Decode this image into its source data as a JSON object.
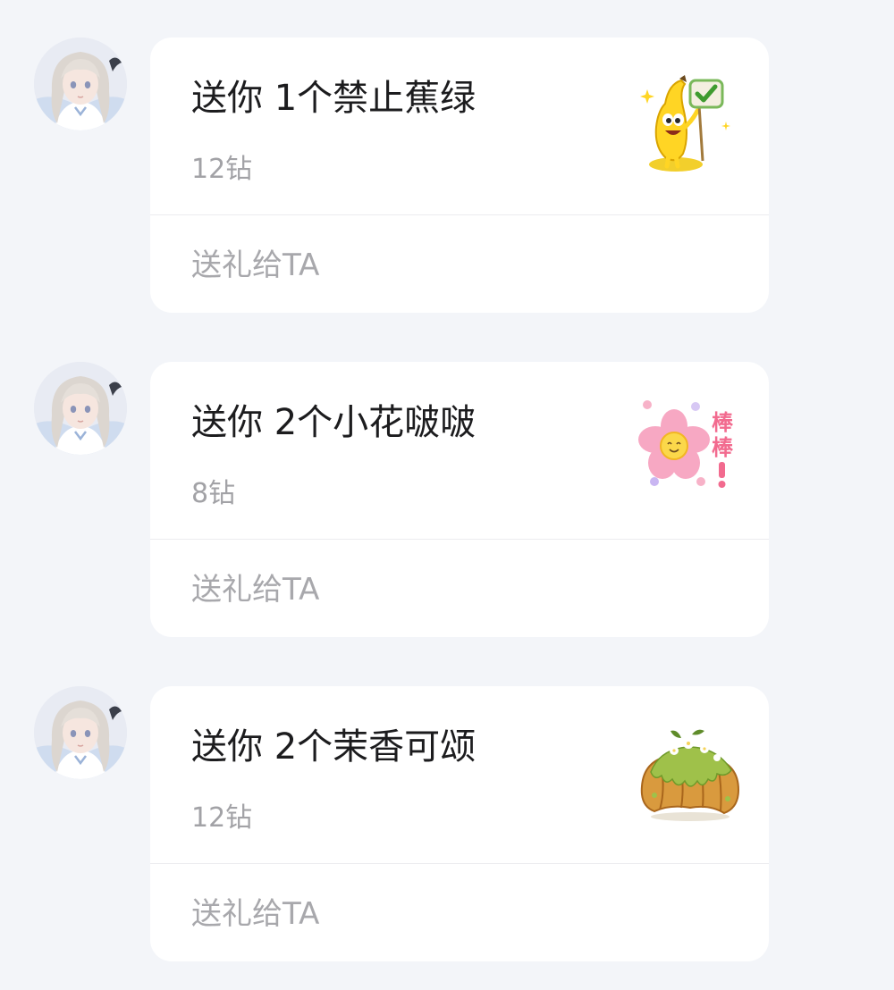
{
  "messages": [
    {
      "avatar_icon": "anime-girl-avatar",
      "gift_title": "送你 1个禁止蕉绿",
      "gift_price": "12钻",
      "gift_icon": "banana-mascot-icon",
      "send_label": "送礼给TA"
    },
    {
      "avatar_icon": "anime-girl-avatar",
      "gift_title": "送你 2个小花啵啵",
      "gift_price": "8钻",
      "gift_icon": "pink-flower-sticker-icon",
      "send_label": "送礼给TA"
    },
    {
      "avatar_icon": "anime-girl-avatar",
      "gift_title": "送你 2个茉香可颂",
      "gift_price": "12钻",
      "gift_icon": "matcha-croissant-icon",
      "send_label": "送礼给TA"
    }
  ],
  "colors": {
    "page_background": "#f3f5f9",
    "card_background": "#ffffff",
    "title_text": "#1c1c1e",
    "secondary_text": "#a2a2a6"
  }
}
